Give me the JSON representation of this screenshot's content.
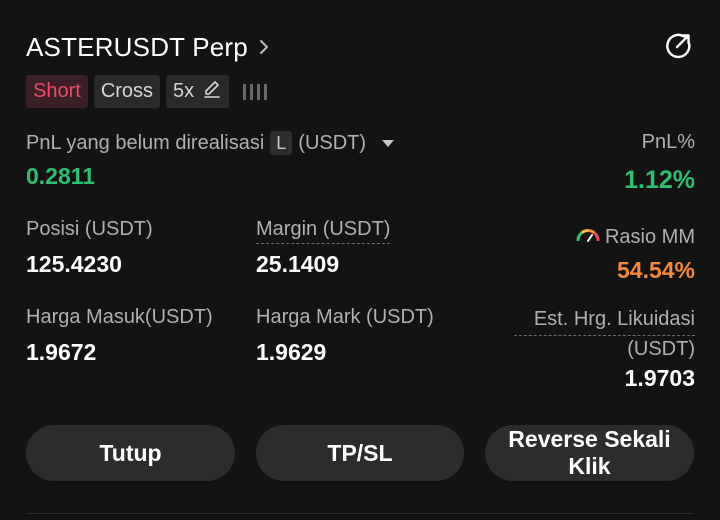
{
  "header": {
    "symbol": "ASTERUSDT Perp"
  },
  "tags": {
    "side": "Short",
    "margin_mode": "Cross",
    "leverage": "5x"
  },
  "pnl": {
    "label": "PnL yang belum direalisasi",
    "badge": "L",
    "unit": "(USDT)",
    "value": "0.2811",
    "pct_label": "PnL%",
    "pct_value": "1.12%"
  },
  "stats": {
    "position_label": "Posisi (USDT)",
    "position_value": "125.4230",
    "margin_label": "Margin (USDT)",
    "margin_value": "25.1409",
    "mm_label": "Rasio MM",
    "mm_value": "54.54%",
    "entry_label": "Harga Masuk(USDT)",
    "entry_value": "1.9672",
    "mark_label": "Harga Mark (USDT)",
    "mark_value": "1.9629",
    "liq_label_1": "Est. Hrg. Likuidasi",
    "liq_label_2": "(USDT)",
    "liq_value": "1.9703"
  },
  "actions": {
    "close": "Tutup",
    "tpsl": "TP/SL",
    "reverse": "Reverse Sekali Klik"
  },
  "colors": {
    "background": "#131313",
    "profit_green": "#2fbf71",
    "short_red": "#ef4b68",
    "mm_orange": "#f5893b"
  },
  "icons": {
    "chevron": "chevron-right-icon",
    "share": "share-external-icon",
    "edit": "pencil-icon",
    "dropdown": "caret-down-icon",
    "gauge": "gauge-icon"
  }
}
